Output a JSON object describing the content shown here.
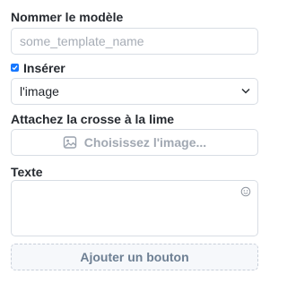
{
  "template_name": {
    "label": "Nommer le modèle",
    "placeholder": "some_template_name"
  },
  "insert": {
    "label": "Insérer",
    "checked": true,
    "selected": "l'image"
  },
  "image": {
    "label": "Attachez la crosse à la lime",
    "button_label": "Choisissez l'image...",
    "icon": "image-icon"
  },
  "text": {
    "label": "Texte",
    "value": "",
    "icon": "emoji-icon"
  },
  "add_button": {
    "label": "Ajouter un bouton"
  },
  "colors": {
    "accent": "#1677ff",
    "border": "#d8dde4"
  }
}
